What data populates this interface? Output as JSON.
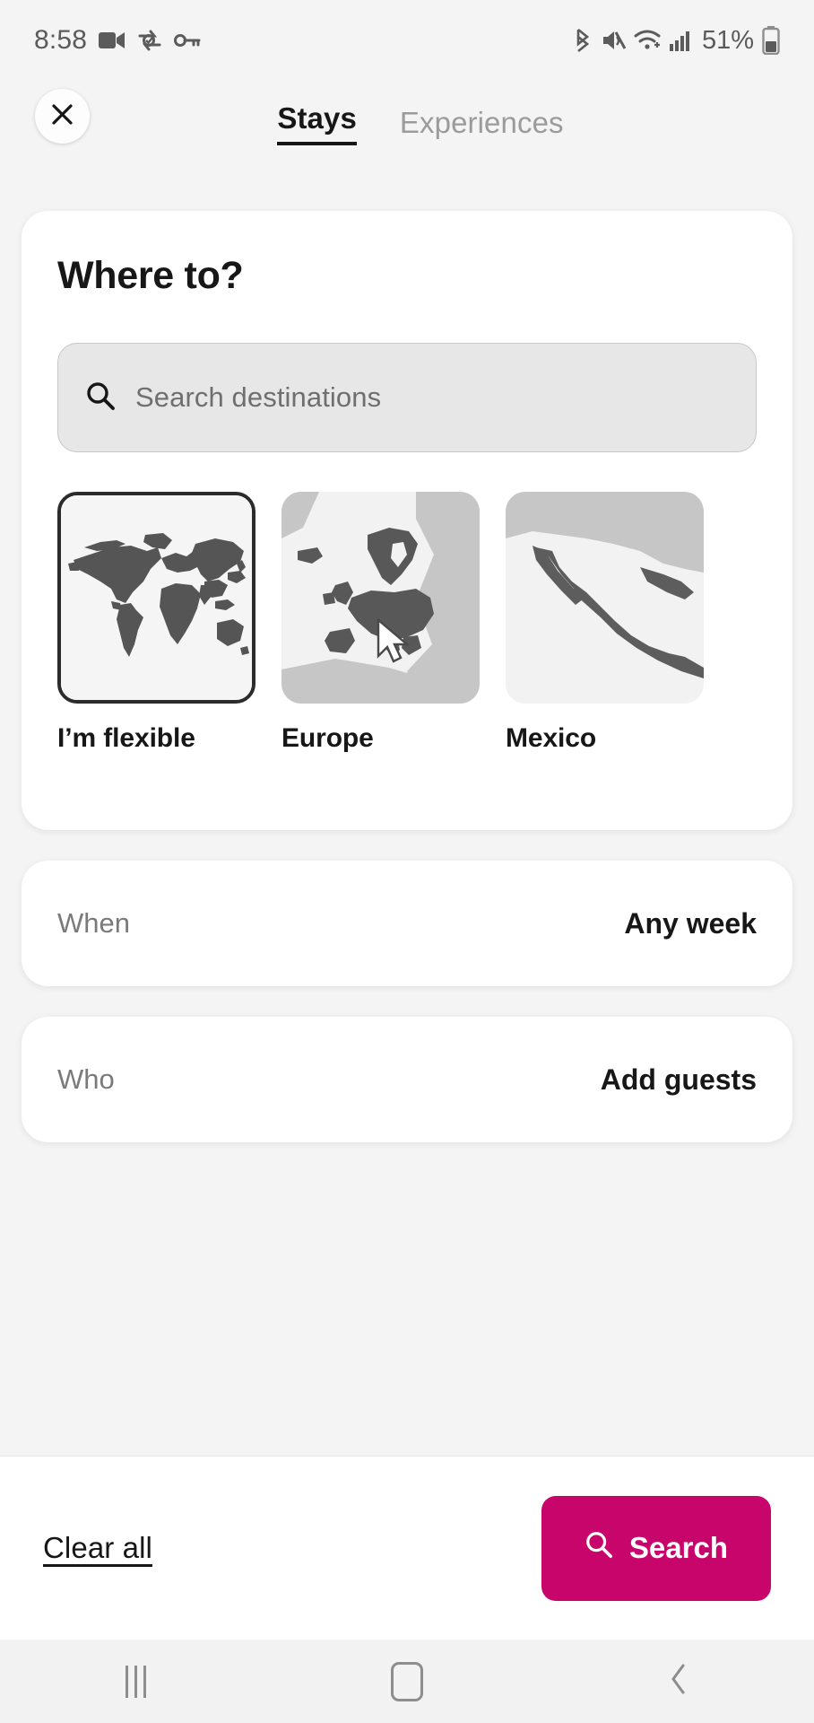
{
  "statusbar": {
    "time": "8:58",
    "left_icons": [
      "video-camera-icon",
      "data-saver-icon",
      "vpn-key-icon"
    ],
    "right_icons": [
      "bluetooth-icon",
      "volume-mute-icon",
      "wifi-icon",
      "cellular-signal-icon"
    ],
    "battery_percent": "51%",
    "battery_icon": "battery-icon",
    "text_color": "#5b5b5b"
  },
  "topbar": {
    "close_icon": "close-icon",
    "tabs": [
      {
        "label": "Stays",
        "active": true
      },
      {
        "label": "Experiences",
        "active": false
      }
    ]
  },
  "where_card": {
    "title": "Where to?",
    "search": {
      "icon": "search-icon",
      "value": "",
      "placeholder": "Search destinations"
    },
    "destinations": [
      {
        "label": "I’m flexible",
        "thumb": "world-map-thumbnail",
        "selected": true
      },
      {
        "label": "Europe",
        "thumb": "europe-map-thumbnail",
        "selected": false
      },
      {
        "label": "Mexico",
        "thumb": "mexico-map-thumbnail",
        "selected": false
      }
    ]
  },
  "when_row": {
    "label": "When",
    "value": "Any week"
  },
  "who_row": {
    "label": "Who",
    "value": "Add guests"
  },
  "footer": {
    "clear_all": "Clear all",
    "search_button": {
      "label": "Search",
      "icon": "search-icon",
      "background": "#c8056b",
      "text_color": "#ffffff"
    }
  },
  "navbar": {
    "recents": "recents-icon",
    "home": "home-icon",
    "back": "back-icon"
  },
  "cursor": {
    "icon": "mouse-pointer-icon"
  },
  "colors": {
    "page_background": "#f4f4f4",
    "card_background": "#ffffff",
    "accent": "#c8056b",
    "primary_text": "#171717",
    "muted_text": "#7a7a7a",
    "search_field": "#e7e7e7"
  }
}
